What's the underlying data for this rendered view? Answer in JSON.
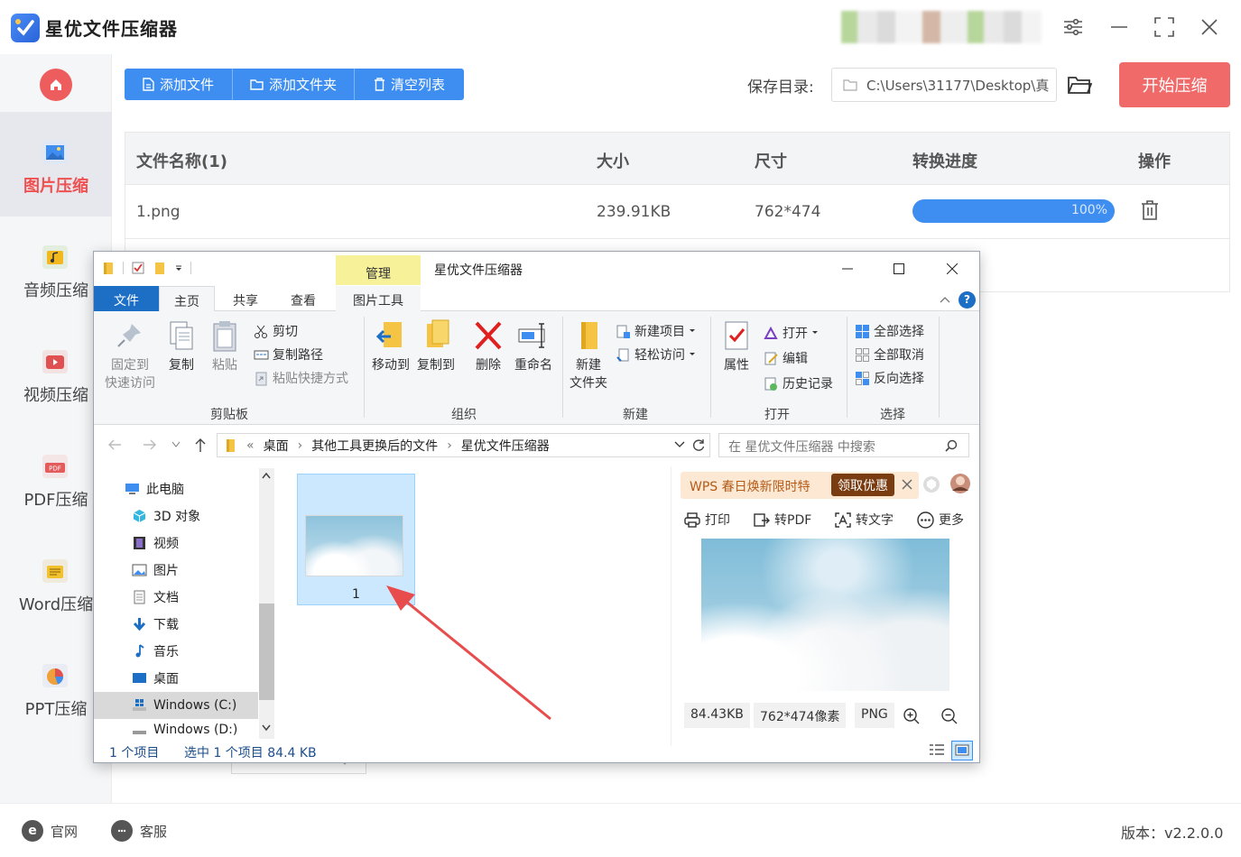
{
  "app": {
    "title": "星优文件压缩器"
  },
  "sidebar": {
    "items": [
      {
        "label": "图片压缩",
        "icon": "image-icon",
        "active": true
      },
      {
        "label": "音频压缩",
        "icon": "audio-icon"
      },
      {
        "label": "视频压缩",
        "icon": "video-icon"
      },
      {
        "label": "PDF压缩",
        "icon": "pdf-icon"
      },
      {
        "label": "Word压缩",
        "icon": "word-icon"
      },
      {
        "label": "PPT压缩",
        "icon": "ppt-icon"
      }
    ]
  },
  "toolbar": {
    "add_file": "添加文件",
    "add_folder": "添加文件夹",
    "clear_list": "清空列表",
    "save_label": "保存目录:",
    "save_path": "C:\\Users\\31177\\Desktop\\真",
    "start": "开始压缩"
  },
  "table": {
    "headers": [
      "文件名称(1)",
      "大小",
      "尺寸",
      "转换进度",
      "操作"
    ],
    "rows": [
      {
        "name": "1.png",
        "size": "239.91KB",
        "dims": "762*474",
        "progress": "100%",
        "progress_value": 100
      }
    ]
  },
  "footer": {
    "website": "官网",
    "support": "客服",
    "version": "版本：v2.2.0.0"
  },
  "explorer": {
    "title": "星优文件压缩器",
    "manage_tab": "管理",
    "tabs": [
      "文件",
      "主页",
      "共享",
      "查看",
      "图片工具"
    ],
    "ribbon": {
      "pin": "固定到\n快速访问",
      "pin_line1": "固定到",
      "pin_line2": "快速访问",
      "copy": "复制",
      "paste": "粘贴",
      "cut": "剪切",
      "copy_path": "复制路径",
      "paste_shortcut": "粘贴快捷方式",
      "group_clipboard": "剪贴板",
      "move_to": "移动到",
      "copy_to": "复制到",
      "delete": "删除",
      "rename": "重命名",
      "group_organize": "组织",
      "new_folder_line1": "新建",
      "new_folder_line2": "文件夹",
      "new_item": "新建项目",
      "easy_access": "轻松访问",
      "group_new": "新建",
      "properties": "属性",
      "open": "打开",
      "edit": "编辑",
      "history": "历史记录",
      "group_open": "打开",
      "select_all": "全部选择",
      "select_none": "全部取消",
      "invert": "反向选择",
      "group_select": "选择"
    },
    "breadcrumb": [
      "«",
      "桌面",
      "其他工具更换后的文件",
      "星优文件压缩器"
    ],
    "search_placeholder": "在 星优文件压缩器 中搜索",
    "nav": [
      "此电脑",
      "3D 对象",
      "视频",
      "图片",
      "文档",
      "下载",
      "音乐",
      "桌面",
      "Windows (C:)",
      "Windows (D:)"
    ],
    "file_name": "1",
    "preview": {
      "ad_text": "WPS 春日焕新限时特",
      "ad_button": "领取优惠",
      "tools": [
        "打印",
        "转PDF",
        "转文字",
        "更多"
      ],
      "size": "84.43KB",
      "dims": "762*474像素",
      "format": "PNG"
    },
    "status": {
      "count": "1 个项目",
      "selected": "选中 1 个项目  84.4 KB"
    }
  },
  "colors": {
    "accent": "#3d8ef0",
    "start_button": "#f06a6a",
    "active_sidebar_text": "#ef5050",
    "explorer_file_tab": "#1c6fc5",
    "manage_tab": "#f7f29a",
    "arrow": "#e84c4c"
  }
}
